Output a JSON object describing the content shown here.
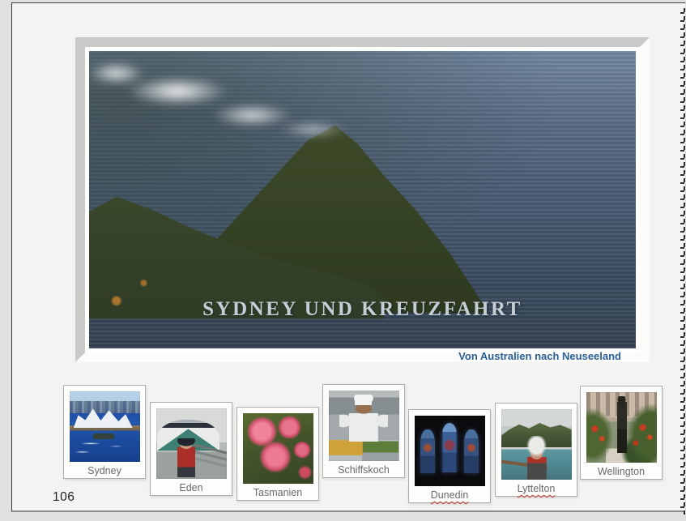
{
  "page": {
    "number": "106",
    "hero": {
      "title": "SYDNEY UND KREUZFAHRT",
      "subtitle": "Von Australien nach Neuseeland",
      "image": "milford-sound-mitre-peak-photo"
    },
    "thumbnails": [
      {
        "caption": "Sydney",
        "image": "sydney-opera-house-photo",
        "misspelled": false
      },
      {
        "caption": "Eden",
        "image": "cruise-ship-and-man-photo",
        "misspelled": false
      },
      {
        "caption": "Tasmanien",
        "image": "pink-pompom-flowers-photo",
        "misspelled": false
      },
      {
        "caption": "Schiffskoch",
        "image": "ship-cook-buffet-photo",
        "misspelled": false
      },
      {
        "caption": "Dunedin",
        "image": "stained-glass-windows-photo",
        "misspelled": true
      },
      {
        "caption": "Lyttelton",
        "image": "harbour-with-person-photo",
        "misspelled": true
      },
      {
        "caption": "Wellington",
        "image": "statue-with-flowers-photo",
        "misspelled": false
      }
    ],
    "colors": {
      "title_silver": "#c6cdd5",
      "subtitle_blue": "#2a5f96",
      "spellcheck_red": "#d03a2e",
      "page_background": "#f3f3f2"
    }
  }
}
